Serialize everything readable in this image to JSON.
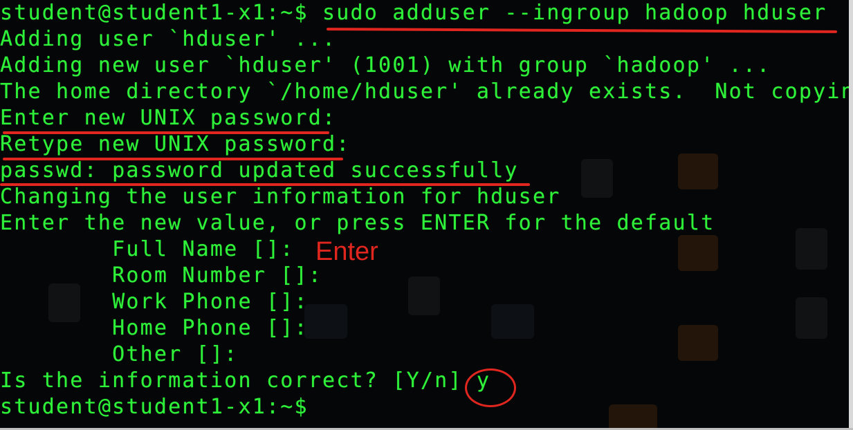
{
  "terminal": {
    "lines": [
      "student@student1-x1:~$ sudo adduser --ingroup hadoop hduser",
      "Adding user `hduser' ...",
      "Adding new user `hduser' (1001) with group `hadoop' ...",
      "The home directory `/home/hduser' already exists.  Not copyin",
      "Enter new UNIX password:",
      "Retype new UNIX password:",
      "passwd: password updated successfully",
      "Changing the user information for hduser",
      "Enter the new value, or press ENTER for the default",
      "        Full Name []:",
      "        Room Number []:",
      "        Work Phone []:",
      "        Home Phone []:",
      "        Other []:",
      "Is the information correct? [Y/n] y",
      "student@student1-x1:~$"
    ],
    "text_color": "#2ef239",
    "background_color": "#050607"
  },
  "annotations": {
    "enter_label": "Enter",
    "color": "#e0261e"
  }
}
